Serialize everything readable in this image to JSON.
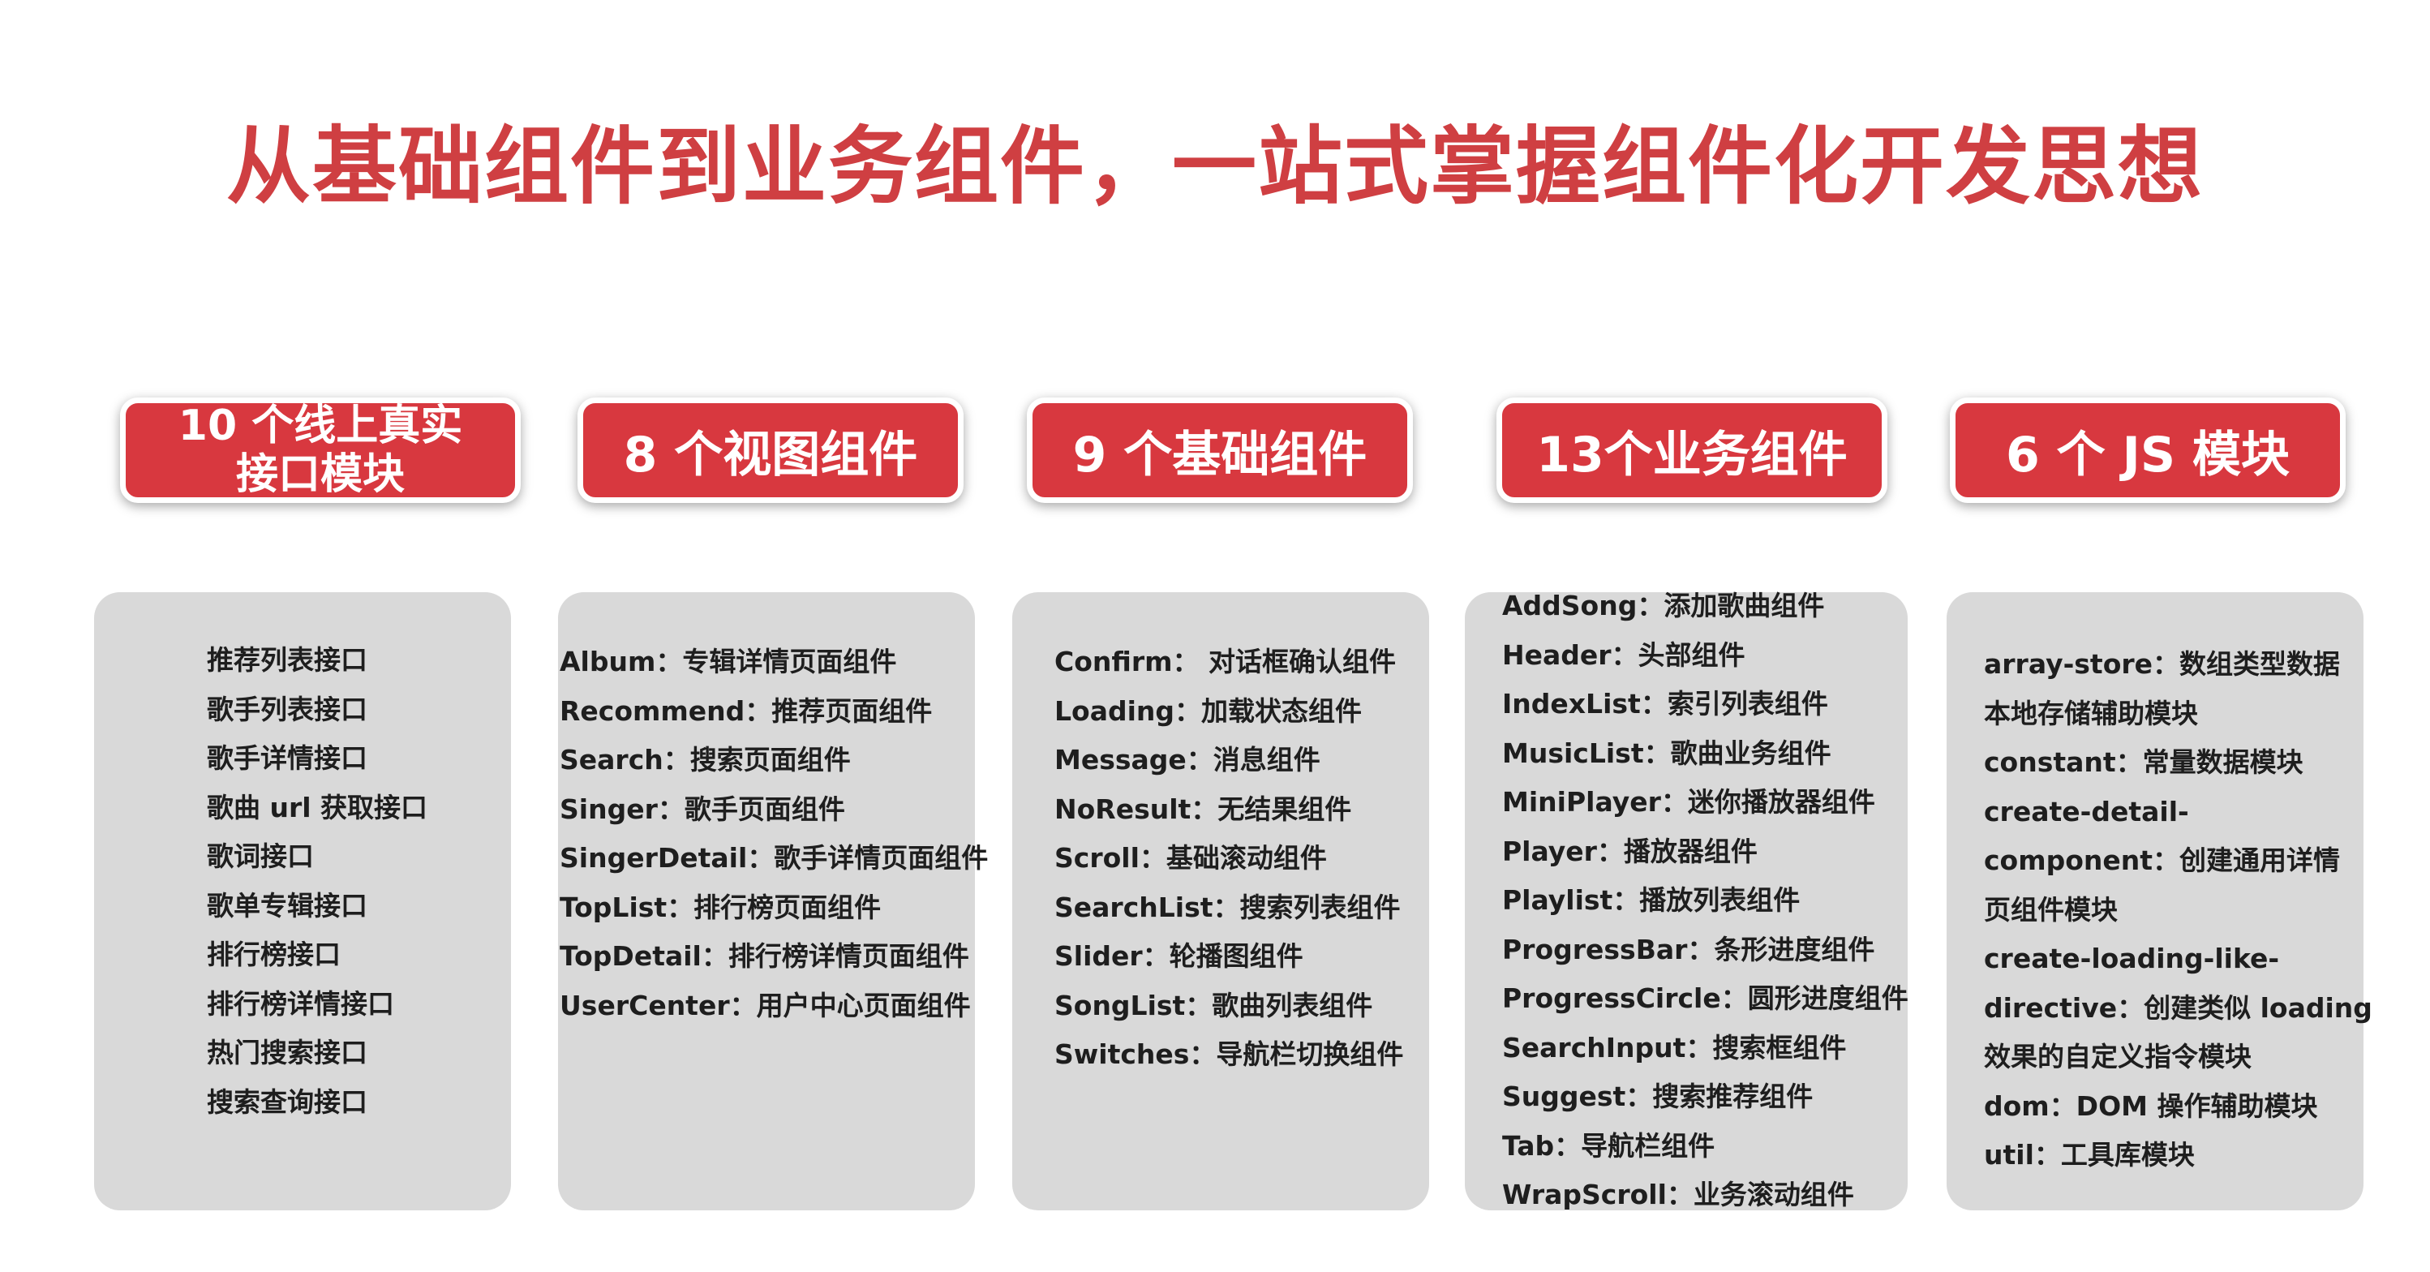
{
  "title": "从基础组件到业务组件，一站式掌握组件化开发思想",
  "categories": [
    {
      "label_line1": "10 个线上真实",
      "label_line2": "接口模块",
      "items": [
        "推荐列表接口",
        "歌手列表接口",
        "歌手详情接口",
        "歌曲 url 获取接口",
        "歌词接口",
        "歌单专辑接口",
        "排行榜接口",
        "排行榜详情接口",
        "热门搜索接口",
        "搜索查询接口"
      ]
    },
    {
      "label": "8 个视图组件",
      "items": [
        "Album：专辑详情页面组件",
        "Recommend：推荐页面组件",
        "Search：搜索页面组件",
        "Singer：歌手页面组件",
        "SingerDetail：歌手详情页面组件",
        "TopList：排行榜页面组件",
        "TopDetail：排行榜详情页面组件",
        "UserCenter：用户中心页面组件"
      ]
    },
    {
      "label": "9 个基础组件",
      "items": [
        "Confirm： 对话框确认组件",
        "Loading：加载状态组件",
        "Message：消息组件",
        "NoResult：无结果组件",
        "Scroll：基础滚动组件",
        "SearchList：搜索列表组件",
        "Slider：轮播图组件",
        "SongList：歌曲列表组件",
        "Switches：导航栏切换组件"
      ]
    },
    {
      "label": "13个业务组件",
      "items": [
        "AddSong：添加歌曲组件",
        "Header：头部组件",
        "IndexList：索引列表组件",
        "MusicList：歌曲业务组件",
        "MiniPlayer：迷你播放器组件",
        "Player：播放器组件",
        "Playlist：播放列表组件",
        "ProgressBar：条形进度组件",
        "ProgressCircle：圆形进度组件",
        "SearchInput：搜索框组件",
        "Suggest：搜索推荐组件",
        "Tab：导航栏组件",
        "WrapScroll：业务滚动组件"
      ]
    },
    {
      "label": "6 个 JS 模块",
      "items": [
        "array-store：数组类型数据",
        "本地存储辅助模块",
        "constant：常量数据模块",
        "create-detail-",
        "component：创建通用详情",
        "页组件模块",
        "create-loading-like-",
        "directive：创建类似 loading",
        "效果的自定义指令模块",
        "dom：DOM 操作辅助模块",
        "util：工具库模块"
      ]
    }
  ]
}
